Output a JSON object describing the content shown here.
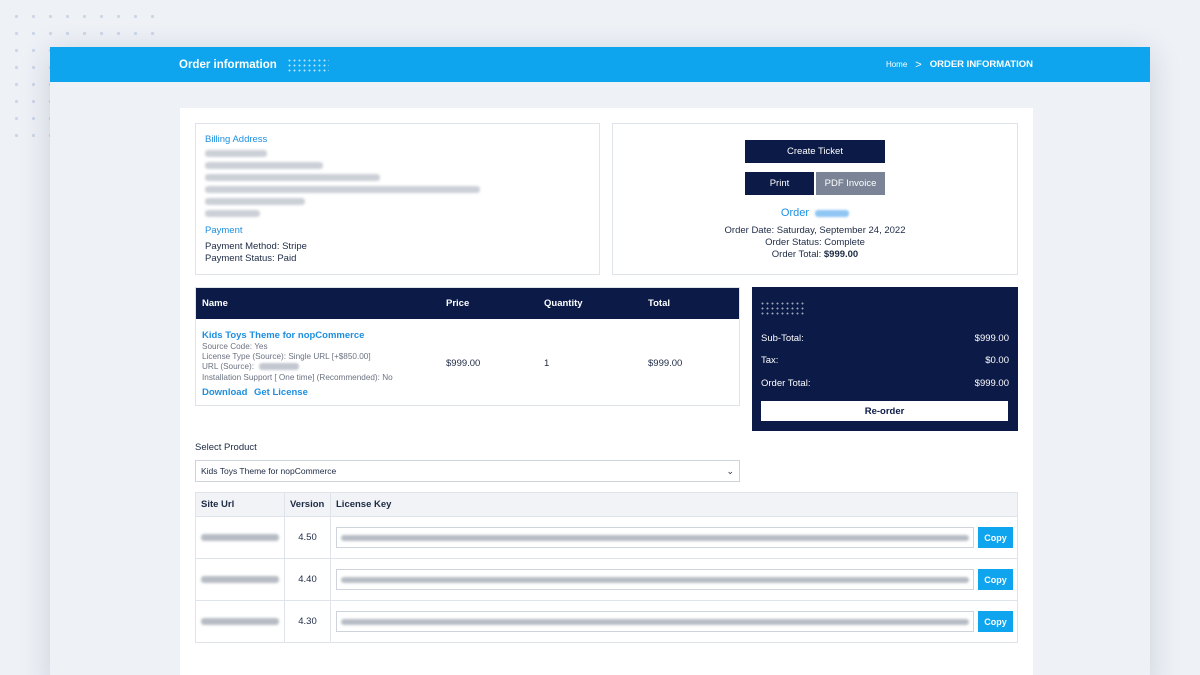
{
  "header": {
    "page_title": "Order information",
    "breadcrumb_home": "Home",
    "breadcrumb_separator": ">",
    "breadcrumb_current": "ORDER INFORMATION"
  },
  "billing": {
    "title": "Billing Address",
    "payment_title": "Payment",
    "payment_method": "Payment Method: Stripe",
    "payment_status": "Payment Status: Paid"
  },
  "actions": {
    "create_ticket": "Create Ticket",
    "print": "Print",
    "pdf_invoice": "PDF Invoice"
  },
  "order": {
    "order_label": "Order",
    "date_label": "Order Date:",
    "date": "Saturday, September 24, 2022",
    "status_label": "Order Status:",
    "status": "Complete",
    "total_label": "Order Total:",
    "total": "$999.00"
  },
  "items": {
    "headers": [
      "Name",
      "Price",
      "Quantity",
      "Total"
    ],
    "product_name": "Kids Toys Theme for nopCommerce",
    "attributes": [
      "Source Code: Yes",
      "License Type (Source): Single URL [+$850.00]",
      "URL (Source):",
      "Installation Support [ One time] (Recommended): No"
    ],
    "download_link": "Download",
    "license_link": "Get License",
    "price": "$999.00",
    "quantity": "1",
    "total": "$999.00"
  },
  "totals": {
    "subtotal_label": "Sub-Total:",
    "subtotal": "$999.00",
    "tax_label": "Tax:",
    "tax": "$0.00",
    "order_total_label": "Order Total:",
    "order_total": "$999.00",
    "reorder": "Re-order"
  },
  "select_product": {
    "label": "Select Product",
    "value": "Kids Toys Theme for nopCommerce"
  },
  "licenses": {
    "headers": [
      "Site Url",
      "Version",
      "License Key"
    ],
    "copy_label": "Copy",
    "rows": [
      {
        "version": "4.50"
      },
      {
        "version": "4.40"
      },
      {
        "version": "4.30"
      }
    ]
  },
  "colors": {
    "accent_blue": "#0ea5ee",
    "navy": "#0b1a47",
    "link_blue": "#1d8fe0"
  }
}
